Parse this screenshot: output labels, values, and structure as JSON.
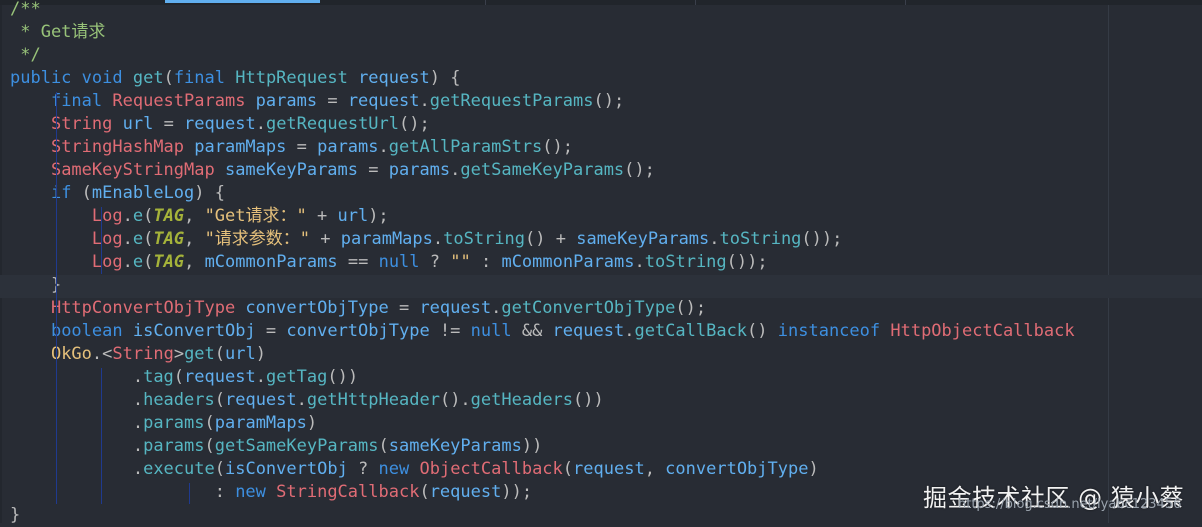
{
  "colors": {
    "background": "#282c34",
    "keyword": "#3d8fe0",
    "type": "#e06c75",
    "method": "#56b6c2",
    "variable": "#61afef",
    "comment": "#98c379",
    "string": "#e5c07b",
    "constant": "#a5b33a",
    "indent_guide": "#1f3a8f"
  },
  "editor": {
    "language": "java",
    "current_line_index": 12,
    "lines": [
      [
        {
          "t": "/**",
          "c": "co"
        }
      ],
      [
        {
          "t": " * Get请求",
          "c": "co"
        }
      ],
      [
        {
          "t": " */",
          "c": "co"
        }
      ],
      [
        {
          "t": "public ",
          "c": "kw"
        },
        {
          "t": "void ",
          "c": "kw"
        },
        {
          "t": "get",
          "c": "fn"
        },
        {
          "t": "(",
          "c": "pl"
        },
        {
          "t": "final ",
          "c": "kw"
        },
        {
          "t": "HttpRequest ",
          "c": "fn"
        },
        {
          "t": "request",
          "c": "va"
        },
        {
          "t": ") {",
          "c": "pl"
        }
      ],
      [
        {
          "t": "    "
        },
        {
          "t": "final ",
          "c": "kw"
        },
        {
          "t": "RequestParams ",
          "c": "ty"
        },
        {
          "t": "params ",
          "c": "va"
        },
        {
          "t": "= ",
          "c": "op"
        },
        {
          "t": "request",
          "c": "va"
        },
        {
          "t": ".",
          "c": "pl"
        },
        {
          "t": "getRequestParams",
          "c": "fn"
        },
        {
          "t": "();",
          "c": "pl"
        }
      ],
      [
        {
          "t": "    "
        },
        {
          "t": "String ",
          "c": "ty"
        },
        {
          "t": "url ",
          "c": "va"
        },
        {
          "t": "= ",
          "c": "op"
        },
        {
          "t": "request",
          "c": "va"
        },
        {
          "t": ".",
          "c": "pl"
        },
        {
          "t": "getRequestUrl",
          "c": "fn"
        },
        {
          "t": "();",
          "c": "pl"
        }
      ],
      [
        {
          "t": "    "
        },
        {
          "t": "StringHashMap ",
          "c": "ty"
        },
        {
          "t": "paramMaps ",
          "c": "va"
        },
        {
          "t": "= ",
          "c": "op"
        },
        {
          "t": "params",
          "c": "va"
        },
        {
          "t": ".",
          "c": "pl"
        },
        {
          "t": "getAllParamStrs",
          "c": "fn"
        },
        {
          "t": "();",
          "c": "pl"
        }
      ],
      [
        {
          "t": "    "
        },
        {
          "t": "SameKeyStringMap ",
          "c": "ty"
        },
        {
          "t": "sameKeyParams ",
          "c": "va"
        },
        {
          "t": "= ",
          "c": "op"
        },
        {
          "t": "params",
          "c": "va"
        },
        {
          "t": ".",
          "c": "pl"
        },
        {
          "t": "getSameKeyParams",
          "c": "fn"
        },
        {
          "t": "();",
          "c": "pl"
        }
      ],
      [
        {
          "t": "    "
        },
        {
          "t": "if ",
          "c": "kw"
        },
        {
          "t": "(",
          "c": "pl"
        },
        {
          "t": "mEnableLog",
          "c": "va"
        },
        {
          "t": ") {",
          "c": "pl"
        }
      ],
      [
        {
          "t": "        "
        },
        {
          "t": "Log",
          "c": "ty"
        },
        {
          "t": ".",
          "c": "pl"
        },
        {
          "t": "e",
          "c": "fn"
        },
        {
          "t": "(",
          "c": "pl"
        },
        {
          "t": "TAG",
          "c": "cn"
        },
        {
          "t": ", ",
          "c": "pl"
        },
        {
          "t": "\"Get请求：\"",
          "c": "st"
        },
        {
          "t": " + ",
          "c": "op"
        },
        {
          "t": "url",
          "c": "va"
        },
        {
          "t": ");",
          "c": "pl"
        }
      ],
      [
        {
          "t": "        "
        },
        {
          "t": "Log",
          "c": "ty"
        },
        {
          "t": ".",
          "c": "pl"
        },
        {
          "t": "e",
          "c": "fn"
        },
        {
          "t": "(",
          "c": "pl"
        },
        {
          "t": "TAG",
          "c": "cn"
        },
        {
          "t": ", ",
          "c": "pl"
        },
        {
          "t": "\"请求参数：\"",
          "c": "st"
        },
        {
          "t": " + ",
          "c": "op"
        },
        {
          "t": "paramMaps",
          "c": "va"
        },
        {
          "t": ".",
          "c": "pl"
        },
        {
          "t": "toString",
          "c": "fn"
        },
        {
          "t": "() + ",
          "c": "pl"
        },
        {
          "t": "sameKeyParams",
          "c": "va"
        },
        {
          "t": ".",
          "c": "pl"
        },
        {
          "t": "toString",
          "c": "fn"
        },
        {
          "t": "());",
          "c": "pl"
        }
      ],
      [
        {
          "t": "        "
        },
        {
          "t": "Log",
          "c": "ty"
        },
        {
          "t": ".",
          "c": "pl"
        },
        {
          "t": "e",
          "c": "fn"
        },
        {
          "t": "(",
          "c": "pl"
        },
        {
          "t": "TAG",
          "c": "cn"
        },
        {
          "t": ", ",
          "c": "pl"
        },
        {
          "t": "mCommonParams ",
          "c": "va"
        },
        {
          "t": "== ",
          "c": "op"
        },
        {
          "t": "null ",
          "c": "kw"
        },
        {
          "t": "? ",
          "c": "op"
        },
        {
          "t": "\"\"",
          "c": "st"
        },
        {
          "t": " : ",
          "c": "op"
        },
        {
          "t": "mCommonParams",
          "c": "va"
        },
        {
          "t": ".",
          "c": "pl"
        },
        {
          "t": "toString",
          "c": "fn"
        },
        {
          "t": "());",
          "c": "pl"
        }
      ],
      [
        {
          "t": "    "
        },
        {
          "t": "}",
          "c": "pl"
        }
      ],
      [
        {
          "t": "    "
        },
        {
          "t": "HttpConvertObjType ",
          "c": "ty"
        },
        {
          "t": "convertObjType ",
          "c": "va"
        },
        {
          "t": "= ",
          "c": "op"
        },
        {
          "t": "request",
          "c": "va"
        },
        {
          "t": ".",
          "c": "pl"
        },
        {
          "t": "getConvertObjType",
          "c": "fn"
        },
        {
          "t": "();",
          "c": "pl"
        }
      ],
      [
        {
          "t": "    "
        },
        {
          "t": "boolean ",
          "c": "kw"
        },
        {
          "t": "isConvertObj ",
          "c": "va"
        },
        {
          "t": "= ",
          "c": "op"
        },
        {
          "t": "convertObjType ",
          "c": "va"
        },
        {
          "t": "!= ",
          "c": "op"
        },
        {
          "t": "null ",
          "c": "kw"
        },
        {
          "t": "&& ",
          "c": "op"
        },
        {
          "t": "request",
          "c": "va"
        },
        {
          "t": ".",
          "c": "pl"
        },
        {
          "t": "getCallBack",
          "c": "fn"
        },
        {
          "t": "() ",
          "c": "pl"
        },
        {
          "t": "instanceof ",
          "c": "kw"
        },
        {
          "t": "HttpObjectCallback",
          "c": "ty"
        }
      ],
      [
        {
          "t": "    "
        },
        {
          "t": "OkGo",
          "c": "ok"
        },
        {
          "t": ".<",
          "c": "pl"
        },
        {
          "t": "String",
          "c": "ty"
        },
        {
          "t": ">",
          "c": "pl"
        },
        {
          "t": "get",
          "c": "fn"
        },
        {
          "t": "(",
          "c": "pl"
        },
        {
          "t": "url",
          "c": "va"
        },
        {
          "t": ")",
          "c": "pl"
        }
      ],
      [
        {
          "t": "            "
        },
        {
          "t": ".",
          "c": "pl"
        },
        {
          "t": "tag",
          "c": "fn"
        },
        {
          "t": "(",
          "c": "pl"
        },
        {
          "t": "request",
          "c": "va"
        },
        {
          "t": ".",
          "c": "pl"
        },
        {
          "t": "getTag",
          "c": "fn"
        },
        {
          "t": "())",
          "c": "pl"
        }
      ],
      [
        {
          "t": "            "
        },
        {
          "t": ".",
          "c": "pl"
        },
        {
          "t": "headers",
          "c": "fn"
        },
        {
          "t": "(",
          "c": "pl"
        },
        {
          "t": "request",
          "c": "va"
        },
        {
          "t": ".",
          "c": "pl"
        },
        {
          "t": "getHttpHeader",
          "c": "fn"
        },
        {
          "t": "().",
          "c": "pl"
        },
        {
          "t": "getHeaders",
          "c": "fn"
        },
        {
          "t": "())",
          "c": "pl"
        }
      ],
      [
        {
          "t": "            "
        },
        {
          "t": ".",
          "c": "pl"
        },
        {
          "t": "params",
          "c": "fn"
        },
        {
          "t": "(",
          "c": "pl"
        },
        {
          "t": "paramMaps",
          "c": "va"
        },
        {
          "t": ")",
          "c": "pl"
        }
      ],
      [
        {
          "t": "            "
        },
        {
          "t": ".",
          "c": "pl"
        },
        {
          "t": "params",
          "c": "fn"
        },
        {
          "t": "(",
          "c": "pl"
        },
        {
          "t": "getSameKeyParams",
          "c": "fn"
        },
        {
          "t": "(",
          "c": "pl"
        },
        {
          "t": "sameKeyParams",
          "c": "va"
        },
        {
          "t": "))",
          "c": "pl"
        }
      ],
      [
        {
          "t": "            "
        },
        {
          "t": ".",
          "c": "pl"
        },
        {
          "t": "execute",
          "c": "fn"
        },
        {
          "t": "(",
          "c": "pl"
        },
        {
          "t": "isConvertObj ",
          "c": "va"
        },
        {
          "t": "? ",
          "c": "op"
        },
        {
          "t": "new ",
          "c": "kw"
        },
        {
          "t": "ObjectCallback",
          "c": "ty"
        },
        {
          "t": "(",
          "c": "pl"
        },
        {
          "t": "request",
          "c": "va"
        },
        {
          "t": ", ",
          "c": "pl"
        },
        {
          "t": "convertObjType",
          "c": "va"
        },
        {
          "t": ")",
          "c": "pl"
        }
      ],
      [
        {
          "t": "                    "
        },
        {
          "t": ": ",
          "c": "op"
        },
        {
          "t": "new ",
          "c": "kw"
        },
        {
          "t": "StringCallback",
          "c": "ty"
        },
        {
          "t": "(",
          "c": "pl"
        },
        {
          "t": "request",
          "c": "va"
        },
        {
          "t": "));",
          "c": "pl"
        }
      ],
      [
        {
          "t": "}",
          "c": "pl"
        }
      ]
    ]
  },
  "watermark": {
    "brand": "掘金技术社区 @ 猿小蔡",
    "url": "https://blog.csdn.net/lyabc123456"
  }
}
